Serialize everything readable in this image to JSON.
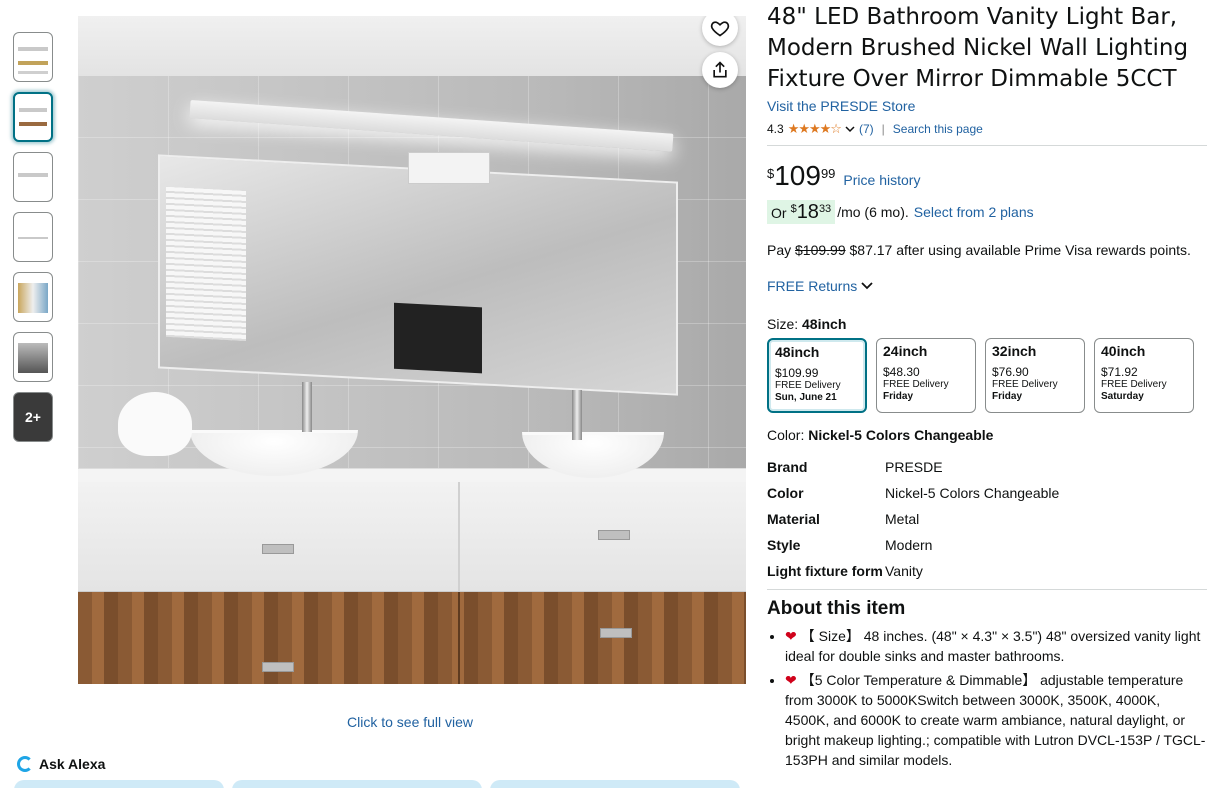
{
  "gallery": {
    "thumbnails": [
      "thumb-1",
      "thumb-2",
      "thumb-3",
      "thumb-4",
      "thumb-5",
      "thumb-6"
    ],
    "more_label": "2+",
    "full_view_label": "Click to see full view"
  },
  "ask_alexa": {
    "label": "Ask Alexa"
  },
  "product": {
    "title": "48\" LED Bathroom Vanity Light Bar, Modern Brushed Nickel Wall Lighting Fixture Over Mirror Dimmable 5CCT",
    "store": "Visit the PRESDE Store",
    "rating": "4.3",
    "stars": "★★★★☆",
    "review_count": "(7)",
    "search_page": "Search this page"
  },
  "price": {
    "symbol": "$",
    "whole": "109",
    "fraction": "99",
    "history_label": "Price history",
    "monthly_prefix": "Or",
    "monthly_symbol": "$",
    "monthly_whole": "18",
    "monthly_fraction": "33",
    "monthly_suffix": "/mo (6 mo).",
    "plans_label": "Select from 2 plans",
    "pay_prefix": "Pay",
    "pay_original": "$109.99",
    "pay_rest": "$87.17 after using available Prime Visa rewards points.",
    "returns_label": "FREE Returns"
  },
  "size": {
    "label": "Size:",
    "selected": "48inch",
    "options": [
      {
        "name": "48inch",
        "price": "$109.99",
        "delivery": "FREE Delivery",
        "day": "Sun, June 21"
      },
      {
        "name": "24inch",
        "price": "$48.30",
        "delivery": "FREE Delivery",
        "day": "Friday"
      },
      {
        "name": "32inch",
        "price": "$76.90",
        "delivery": "FREE Delivery",
        "day": "Friday"
      },
      {
        "name": "40inch",
        "price": "$71.92",
        "delivery": "FREE Delivery",
        "day": "Saturday"
      }
    ]
  },
  "color": {
    "label": "Color:",
    "selected": "Nickel-5 Colors Changeable"
  },
  "specs": [
    {
      "key": "Brand",
      "value": "PRESDE"
    },
    {
      "key": "Color",
      "value": "Nickel-5 Colors Changeable"
    },
    {
      "key": "Material",
      "value": "Metal"
    },
    {
      "key": "Style",
      "value": "Modern"
    },
    {
      "key": "Light fixture form",
      "value": "Vanity"
    }
  ],
  "about": {
    "heading": "About this item",
    "bullets": [
      "【 Size】 48 inches. (48\" × 4.3\" × 3.5\") 48\" oversized vanity light ideal for double sinks and master bathrooms.",
      "【5 Color Temperature & Dimmable】 adjustable temperature from 3000K to 5000KSwitch between 3000K, 3500K, 4000K, 4500K, and 6000K to create warm ambiance, natural daylight, or bright makeup lighting.; compatible with Lutron DVCL-153P / TGCL-153PH and similar models."
    ]
  },
  "colors": {
    "link": "#2162a1",
    "star": "#de7921",
    "accent": "#007185",
    "heart": "#d0021b"
  },
  "icons": {
    "wishlist": "heart-outline-icon",
    "share": "share-icon",
    "returns_chevron": "chevron-down-icon",
    "alexa": "alexa-icon",
    "bullet": "heart-icon"
  }
}
